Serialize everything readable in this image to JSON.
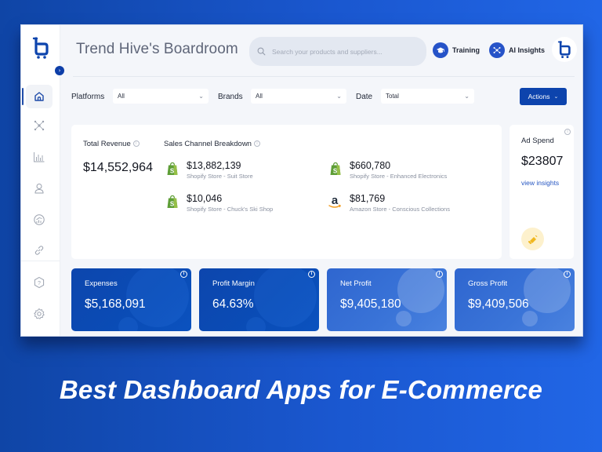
{
  "app": {
    "title": "Trend Hive's Boardroom",
    "brand_color": "#0d44ad"
  },
  "header": {
    "search_placeholder": "Search your products and suppliers...",
    "training_label": "Training",
    "ai_insights_label": "AI Insights"
  },
  "sidebar": {
    "items": [
      {
        "name": "home",
        "icon": "home-icon",
        "active": true
      },
      {
        "name": "network",
        "icon": "network-icon",
        "active": false
      },
      {
        "name": "analytics",
        "icon": "bar-chart-icon",
        "active": false
      },
      {
        "name": "users",
        "icon": "user-icon",
        "active": false
      },
      {
        "name": "growth",
        "icon": "growth-chart-icon",
        "active": false
      },
      {
        "name": "integrations",
        "icon": "link-icon",
        "active": false
      },
      {
        "name": "help",
        "icon": "help-icon",
        "active": false
      },
      {
        "name": "settings",
        "icon": "gear-icon",
        "active": false
      }
    ]
  },
  "filters": {
    "platforms_label": "Platforms",
    "platforms_value": "All",
    "brands_label": "Brands",
    "brands_value": "All",
    "date_label": "Date",
    "date_value": "Total",
    "actions_label": "Actions"
  },
  "revenue": {
    "total_label": "Total Revenue",
    "total_value": "$14,552,964",
    "breakdown_label": "Sales Channel Breakdown",
    "channels": [
      {
        "amount": "$13,882,139",
        "name": "Shopify Store - Suit Store",
        "platform": "shopify"
      },
      {
        "amount": "$10,046",
        "name": "Shopify Store - Chuck's Ski Shop",
        "platform": "shopify"
      },
      {
        "amount": "$660,780",
        "name": "Shopify Store - Enhanced Electronics",
        "platform": "shopify"
      },
      {
        "amount": "$81,769",
        "name": "Amazon Store - Conscious Collections",
        "platform": "amazon"
      }
    ]
  },
  "ad_spend": {
    "title": "Ad Spend",
    "value": "$23807",
    "link": "view insights"
  },
  "kpis": [
    {
      "title": "Expenses",
      "value": "$5,168,091"
    },
    {
      "title": "Profit Margin",
      "value": "64.63%"
    },
    {
      "title": "Net Profit",
      "value": "$9,405,180"
    },
    {
      "title": "Gross Profit",
      "value": "$9,409,506"
    }
  ],
  "headline": "Best Dashboard Apps for E-Commerce",
  "icons": {
    "info": "i",
    "chevron": "⌄",
    "collapse": "›"
  }
}
